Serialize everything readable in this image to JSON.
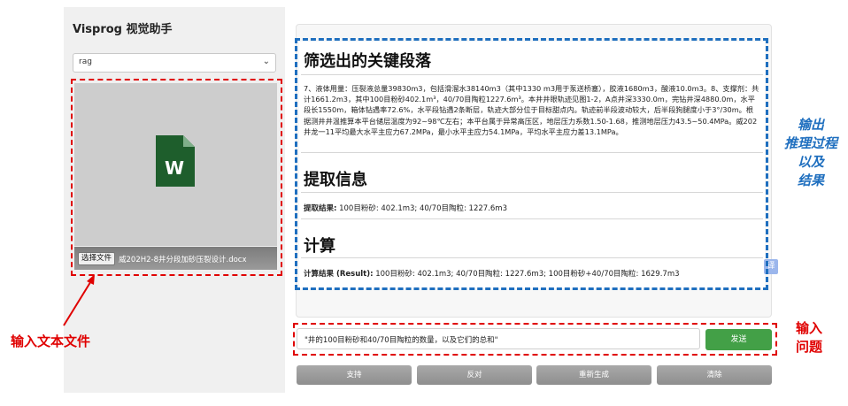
{
  "app": {
    "title": "Visprog 视觉助手"
  },
  "sidebar": {
    "mode_select": {
      "value": "rag"
    },
    "file_input": {
      "button_label": "选择文件",
      "file_name": "威202H2-8井分段加砂压裂设计.docx"
    }
  },
  "content": {
    "sections": [
      {
        "heading": "筛选出的关键段落",
        "body": "7、液体用量：压裂液总量39830m3，包括滑溜水38140m3（其中1330 m3用于泵送桥塞），胶液1680m3，酸液10.0m3。8、支撑剂：共计1661.2m3，其中100目粉砂402.1m³，40/70目陶粒1227.6m³。本井井眼轨迹见图1-2，A点井深3330.0m，完钻井深4880.0m，水平段长1550m，箱体钻遇率72.6%，水平段钻遇2条断层，轨迹大部分位于目标甜点内。轨迹前半段波动较大，后半段狗腿度小于3°/30m。根据测井井温推算本平台储层温度为92~98℃左右；本平台属于异常高压区，地层压力系数1.50-1.68，推测地层压力43.5~50.4MPa。威202井龙一11平均最大水平主应力67.2MPa，最小水平主应力54.1MPa，平均水平主应力差13.1MPa。"
      },
      {
        "heading": "提取信息",
        "result_label": "提取结果:",
        "result_value": " 100目粉砂: 402.1m3; 40/70目陶粒: 1227.6m3"
      },
      {
        "heading": "计算",
        "result_label": "计算结果 (Result):",
        "result_value": " 100目粉砂: 402.1m3; 40/70目陶粒: 1227.6m3; 100目粉砂+40/70目陶粒: 1629.7m3"
      }
    ],
    "translate_badge": "译"
  },
  "chat": {
    "question_value": "\"井的100目粉砂和40/70目陶粒的数量，以及它们的总和\"",
    "send_label": "发送"
  },
  "actions": {
    "support": "支持",
    "oppose": "反对",
    "regenerate": "重新生成",
    "clear": "清除"
  },
  "annotations": {
    "input_file": "输入文本文件",
    "output": [
      "输出",
      "推理过程",
      "以及",
      "结果"
    ],
    "input_question": [
      "输入",
      "问题"
    ]
  },
  "colors": {
    "send": "#43a047",
    "annotation_red": "#e00000",
    "annotation_blue": "#1f6fbf",
    "word_icon": "#1e5e2c"
  },
  "icons": {
    "file": "word-document-icon",
    "select": "chevron-down-icon"
  }
}
